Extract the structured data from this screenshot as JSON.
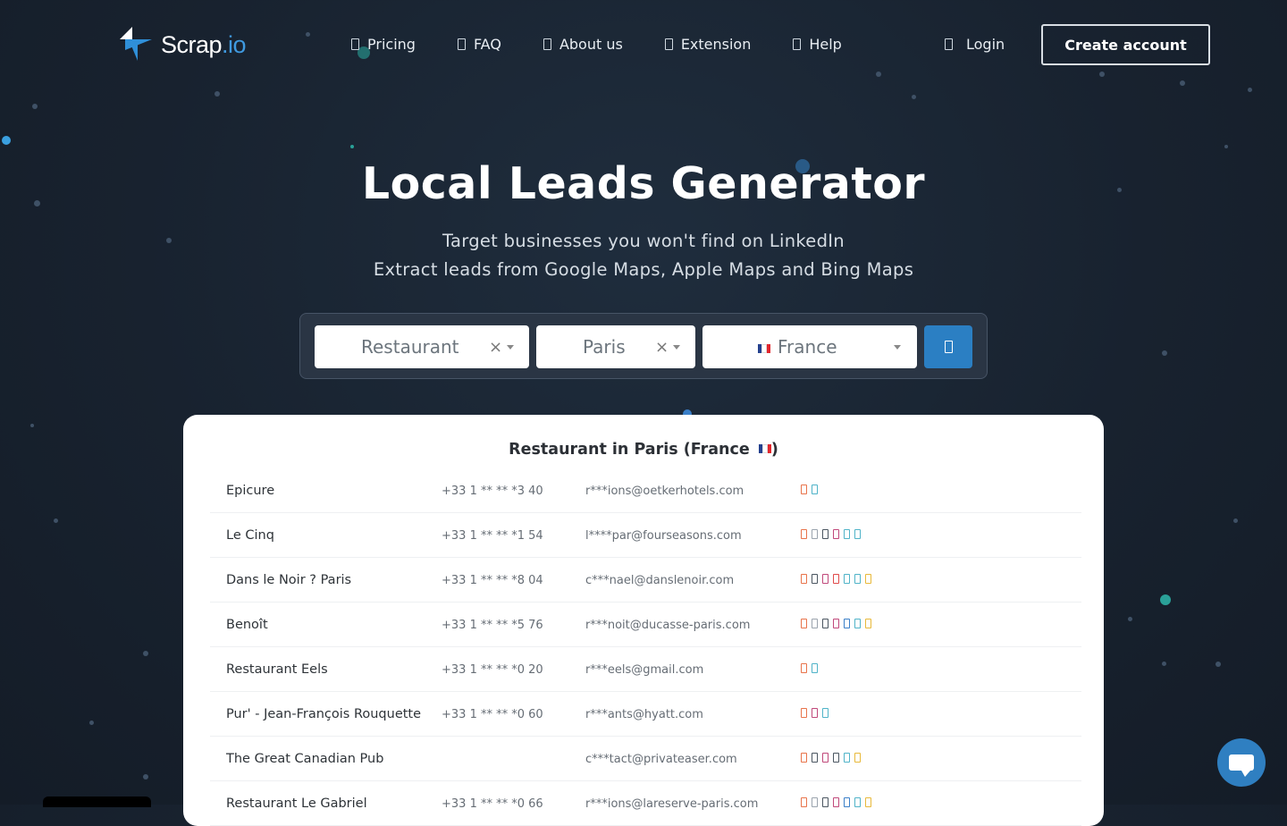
{
  "brand": {
    "name": "Scrap",
    "suffix": ".io",
    "accent": "#2f8fd8"
  },
  "nav": [
    {
      "label": "Pricing",
      "icon": "tag-icon"
    },
    {
      "label": "FAQ",
      "icon": "question-icon"
    },
    {
      "label": "About us",
      "icon": "info-icon"
    },
    {
      "label": "Extension",
      "icon": "puzzle-icon"
    },
    {
      "label": "Help",
      "icon": "help-icon"
    }
  ],
  "auth": {
    "login": "Login",
    "create": "Create account"
  },
  "hero": {
    "title": "Local Leads Generator",
    "subtitle1": "Target businesses you won't find on LinkedIn",
    "subtitle2": "Extract leads from Google Maps, Apple Maps and Bing Maps"
  },
  "search": {
    "category": "Restaurant",
    "city": "Paris",
    "country": "France",
    "clear_glyph": "×",
    "submit_icon": "search-icon"
  },
  "results": {
    "title": "Restaurant in Paris (France",
    "title_close": ")",
    "rows": [
      {
        "name": "Epicure",
        "phone": "+33 1 ** ** *3 40",
        "email": "r***ions@oetkerhotels.com",
        "icons": [
          "#e8734a",
          "#4fb3c8"
        ]
      },
      {
        "name": "Le Cinq",
        "phone": "+33 1 ** ** *1 54",
        "email": "l****par@fourseasons.com",
        "icons": [
          "#e8734a",
          "#9aa3ad",
          "#4a5560",
          "#c0487a",
          "#4fb3c8",
          "#4fb3c8"
        ]
      },
      {
        "name": "Dans le Noir ? Paris",
        "phone": "+33 1 ** ** *8 04",
        "email": "c***nael@danslenoir.com",
        "icons": [
          "#e8734a",
          "#4a5560",
          "#c0487a",
          "#e04a4a",
          "#4fb3c8",
          "#4fb3c8",
          "#e8b93a"
        ]
      },
      {
        "name": "Benoît",
        "phone": "+33 1 ** ** *5 76",
        "email": "r***noit@ducasse-paris.com",
        "icons": [
          "#e8734a",
          "#9aa3ad",
          "#4a5560",
          "#c0487a",
          "#3a7fc8",
          "#4fb3c8",
          "#e8b93a"
        ]
      },
      {
        "name": "Restaurant Eels",
        "phone": "+33 1 ** ** *0 20",
        "email": "r***eels@gmail.com",
        "icons": [
          "#e8734a",
          "#4fb3c8"
        ]
      },
      {
        "name": "Pur' - Jean-François Rouquette",
        "phone": "+33 1 ** ** *0 60",
        "email": "r***ants@hyatt.com",
        "icons": [
          "#e8734a",
          "#c0487a",
          "#4fb3c8"
        ]
      },
      {
        "name": "The Great Canadian Pub",
        "phone": "",
        "email": "c***tact@privateaser.com",
        "icons": [
          "#e8734a",
          "#4a5560",
          "#c0487a",
          "#4a5560",
          "#4fb3c8",
          "#e8b93a"
        ]
      },
      {
        "name": "Restaurant Le Gabriel",
        "phone": "+33 1 ** ** *0 66",
        "email": "r***ions@lareserve-paris.com",
        "icons": [
          "#e8734a",
          "#9aa3ad",
          "#4a5560",
          "#c0487a",
          "#3a7fc8",
          "#4fb3c8",
          "#e8b93a"
        ]
      }
    ]
  },
  "chat": {
    "icon": "chat-icon"
  }
}
